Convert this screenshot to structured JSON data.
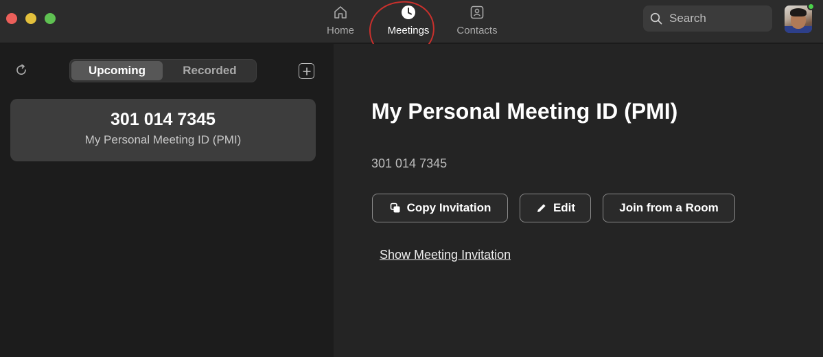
{
  "titlebar": {
    "nav": {
      "home": {
        "label": "Home",
        "icon": "home-icon"
      },
      "meetings": {
        "label": "Meetings",
        "icon": "clock-icon"
      },
      "contacts": {
        "label": "Contacts",
        "icon": "contact-card-icon"
      }
    },
    "search": {
      "placeholder": "Search"
    },
    "avatar": {
      "status_color": "#4bd14b"
    },
    "annotation_color": "#c9302c"
  },
  "left": {
    "tabs": {
      "upcoming": "Upcoming",
      "recorded": "Recorded"
    },
    "meeting": {
      "id": "301 014 7345",
      "name": "My Personal Meeting ID (PMI)"
    }
  },
  "detail": {
    "title": "My Personal Meeting ID (PMI)",
    "meeting_number": "301 014 7345",
    "buttons": {
      "copy": "Copy Invitation",
      "edit": "Edit",
      "join": "Join from a Room"
    },
    "show_invitation": "Show Meeting Invitation"
  }
}
